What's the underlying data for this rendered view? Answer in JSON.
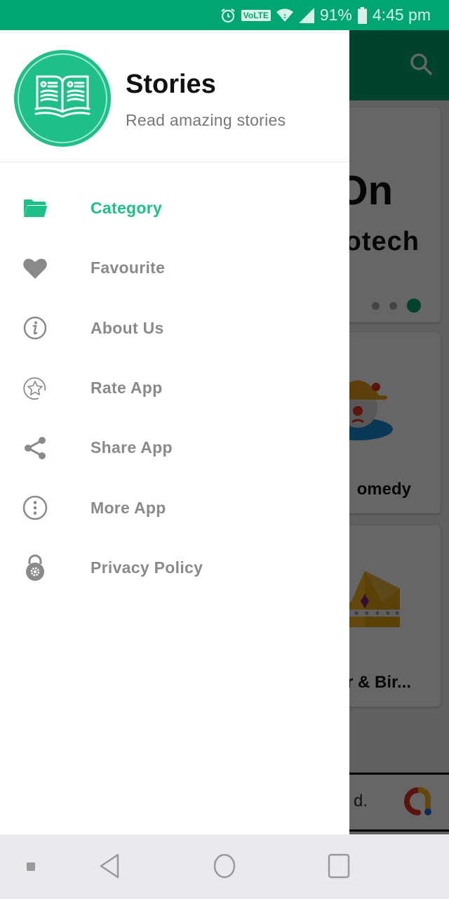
{
  "status_bar": {
    "battery_percent": "91%",
    "time": "4:45 pm",
    "volte_label": "VoLTE",
    "icons": [
      "alarm-icon",
      "volte-icon",
      "wifi-icon",
      "signal-icon",
      "battery-icon"
    ]
  },
  "background_app": {
    "toolbar_icon": "search-icon",
    "banner": {
      "title_fragment": "On",
      "subtitle_fragment": "otech",
      "carousel_pages": 3,
      "carousel_active_index": 2
    },
    "categories": [
      {
        "label": "omedy",
        "icon": "clown-icon"
      },
      {
        "label": "ar & Bir...",
        "icon": "crown-icon"
      }
    ],
    "ad": {
      "text_fragment": "d.",
      "icon": "ad-logo-icon"
    }
  },
  "drawer": {
    "header": {
      "title": "Stories",
      "subtitle": "Read amazing stories",
      "logo_icon": "open-book-icon"
    },
    "menu_items": [
      {
        "label": "Category",
        "icon": "folder-icon",
        "active": true
      },
      {
        "label": "Favourite",
        "icon": "heart-icon",
        "active": false
      },
      {
        "label": "About Us",
        "icon": "info-icon",
        "active": false
      },
      {
        "label": "Rate App",
        "icon": "star-icon",
        "active": false
      },
      {
        "label": "Share App",
        "icon": "share-icon",
        "active": false
      },
      {
        "label": "More App",
        "icon": "more-vertical-icon",
        "active": false
      },
      {
        "label": "Privacy Policy",
        "icon": "lock-gear-icon",
        "active": false
      }
    ]
  },
  "colors": {
    "accent": "#1fbf8a",
    "status_bar": "#00a572",
    "menu_text": "#8a8a8a",
    "title_text": "#111111",
    "subtitle_text": "#777777"
  },
  "nav_bar": {
    "buttons": [
      "menu-dot",
      "back",
      "home",
      "recents"
    ]
  }
}
